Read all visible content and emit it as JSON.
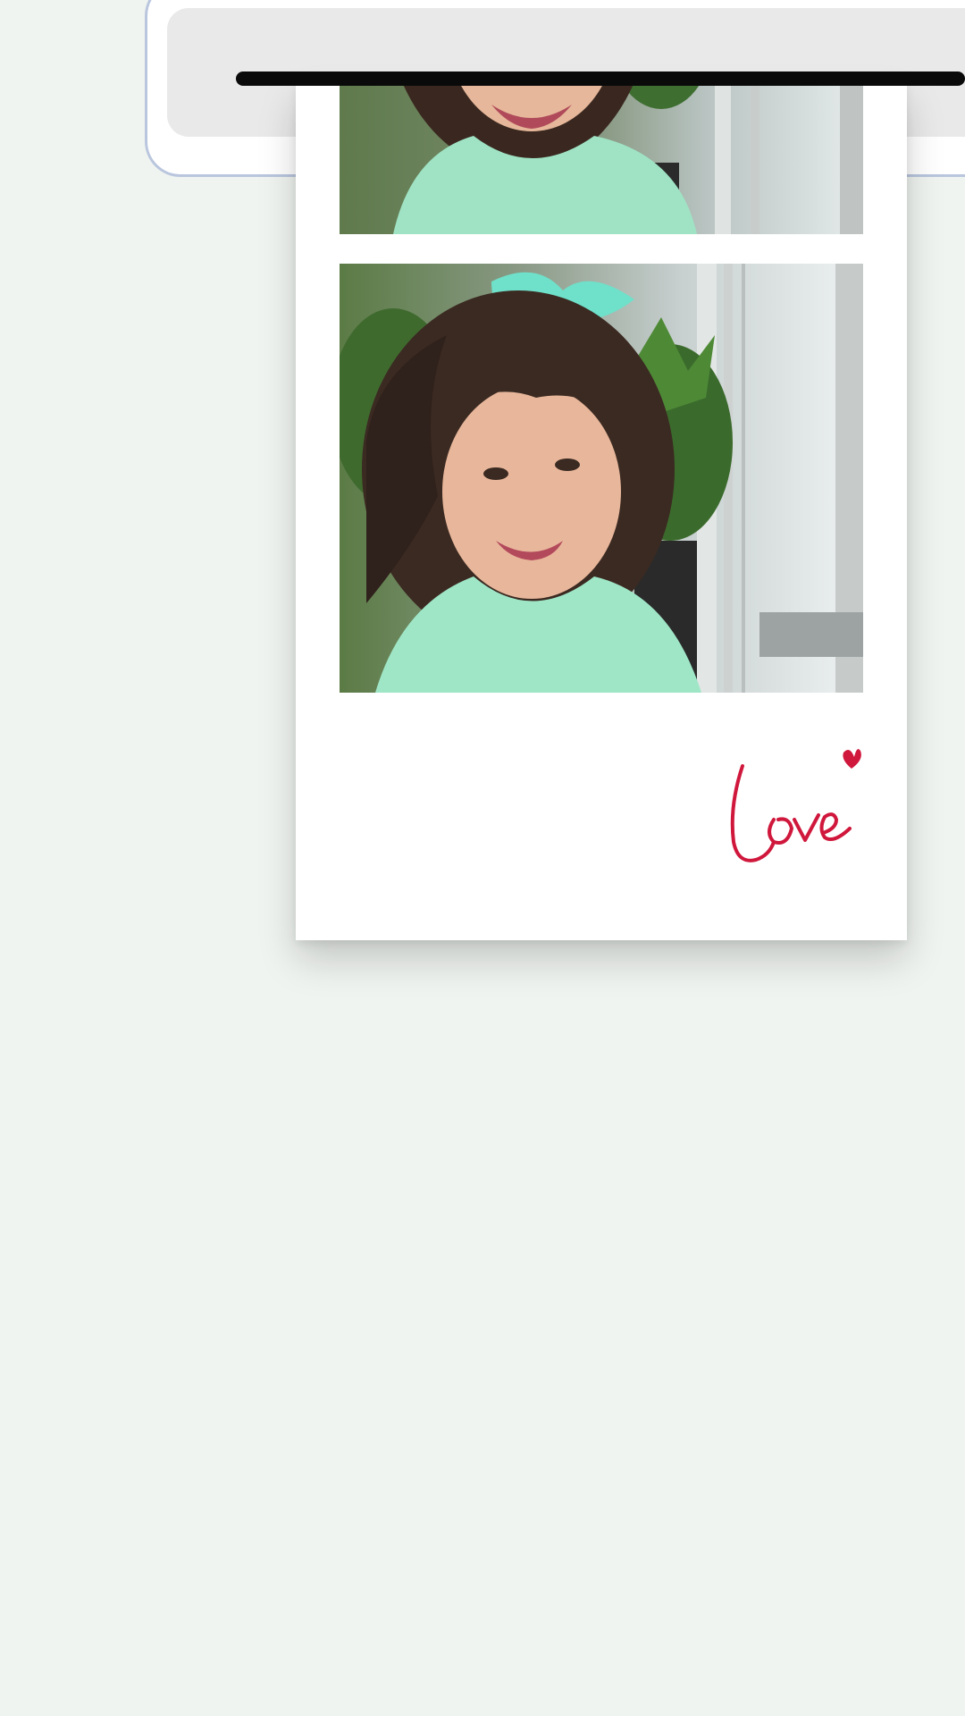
{
  "printer": {
    "icon": "printer-slot"
  },
  "strip": {
    "photos": [
      {
        "name": "photo-top",
        "subject": "girl-portrait"
      },
      {
        "name": "photo-bottom",
        "subject": "girl-portrait"
      }
    ],
    "signature_text": "love",
    "signature_color": "#d0173c"
  },
  "colors": {
    "background": "#f0f4f0",
    "housing_border": "#b9c6de",
    "housing_fill": "#e9e9e9",
    "slot": "#0a0a0a",
    "paper": "#ffffff"
  }
}
